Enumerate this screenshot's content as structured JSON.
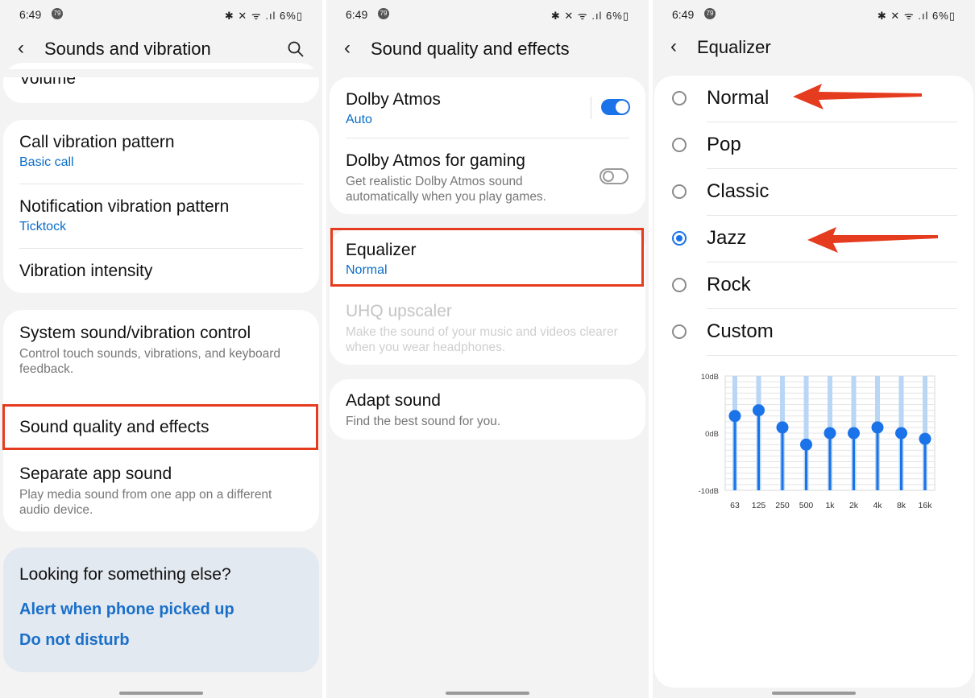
{
  "status": {
    "time": "6:49",
    "badge": "79",
    "icons_text": "✱ ✕ ᯤ .ıl 6%▯",
    "battery": "6%"
  },
  "panel1": {
    "title": "Sounds and vibration",
    "partial_item": "Volume",
    "items": [
      {
        "title": "Call vibration pattern",
        "sub": "Basic call"
      },
      {
        "title": "Notification vibration pattern",
        "sub": "Ticktock"
      },
      {
        "title": "Vibration intensity"
      }
    ],
    "system": {
      "title": "System sound/vibration control",
      "desc": "Control touch sounds, vibrations, and keyboard feedback."
    },
    "sound_quality": {
      "title": "Sound quality and effects"
    },
    "separate": {
      "title": "Separate app sound",
      "desc": "Play media sound from one app on a different audio device."
    },
    "looking": {
      "title": "Looking for something else?",
      "links": [
        "Alert when phone picked up",
        "Do not disturb"
      ]
    }
  },
  "panel2": {
    "title": "Sound quality and effects",
    "dolby": {
      "title": "Dolby Atmos",
      "sub": "Auto",
      "on": true
    },
    "dolby_gaming": {
      "title": "Dolby Atmos for gaming",
      "desc": "Get realistic Dolby Atmos sound automatically when you play games.",
      "on": false
    },
    "equalizer": {
      "title": "Equalizer",
      "sub": "Normal"
    },
    "uhq": {
      "title": "UHQ upscaler",
      "desc": "Make the sound of your music and videos clearer when you wear headphones."
    },
    "adapt": {
      "title": "Adapt sound",
      "desc": "Find the best sound for you."
    }
  },
  "panel3": {
    "title": "Equalizer",
    "options": [
      "Normal",
      "Pop",
      "Classic",
      "Jazz",
      "Rock",
      "Custom"
    ],
    "selected": "Jazz",
    "colors": {
      "accent": "#1a73e8",
      "arrow": "#e53b1e",
      "link": "#1a6fc9"
    }
  },
  "chart_data": {
    "type": "bar",
    "categories": [
      "63",
      "125",
      "250",
      "500",
      "1k",
      "2k",
      "4k",
      "8k",
      "16k"
    ],
    "values": [
      3,
      4,
      1,
      -2,
      0,
      0,
      1,
      0,
      -1
    ],
    "ylabel_ticks": [
      "10dB",
      "0dB",
      "-10dB"
    ],
    "ylim": [
      -10,
      10
    ],
    "grid": true
  }
}
